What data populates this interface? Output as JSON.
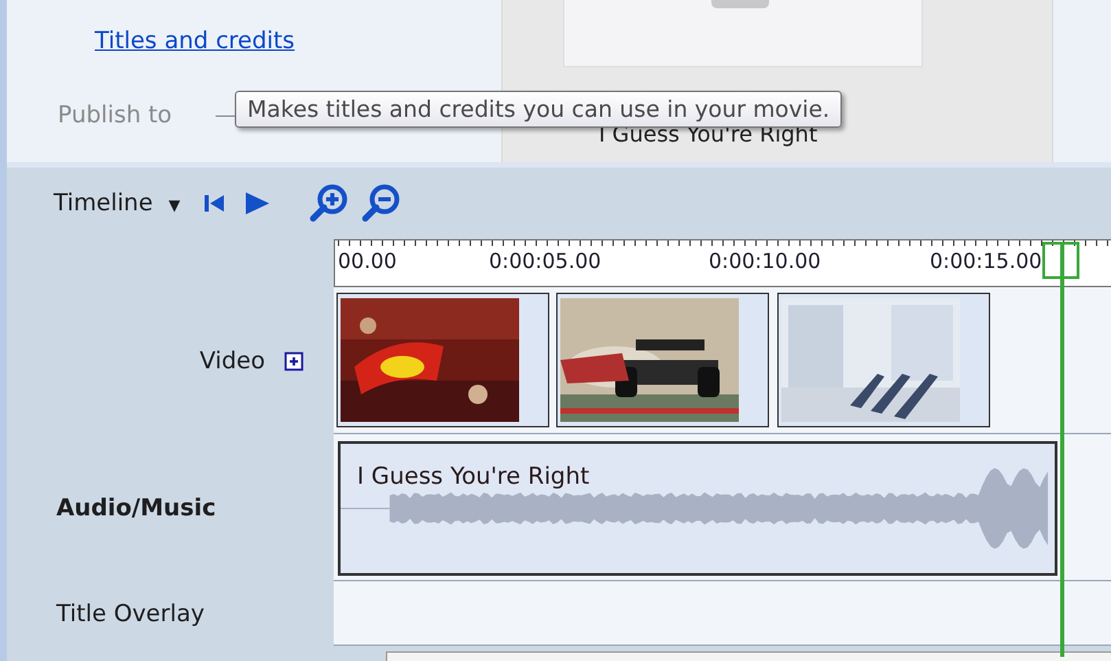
{
  "top_panel": {
    "link": "Titles and credits",
    "publish_label": "Publish to",
    "preview_caption": "I Guess You're Right",
    "tooltip": "Makes titles and credits you can use in your movie."
  },
  "timeline": {
    "label": "Timeline",
    "dropdown_glyph": "▼",
    "ruler": [
      "00.00",
      "0:00:05.00",
      "0:00:10.00",
      "0:00:15.00"
    ],
    "tracks": [
      {
        "name": "Video",
        "kind": "video",
        "selected": false
      },
      {
        "name": "Audio/Music",
        "kind": "audio",
        "selected": true,
        "clip_title": "I Guess You're Right"
      },
      {
        "name": "Title Overlay",
        "kind": "overlay",
        "selected": false
      }
    ]
  }
}
